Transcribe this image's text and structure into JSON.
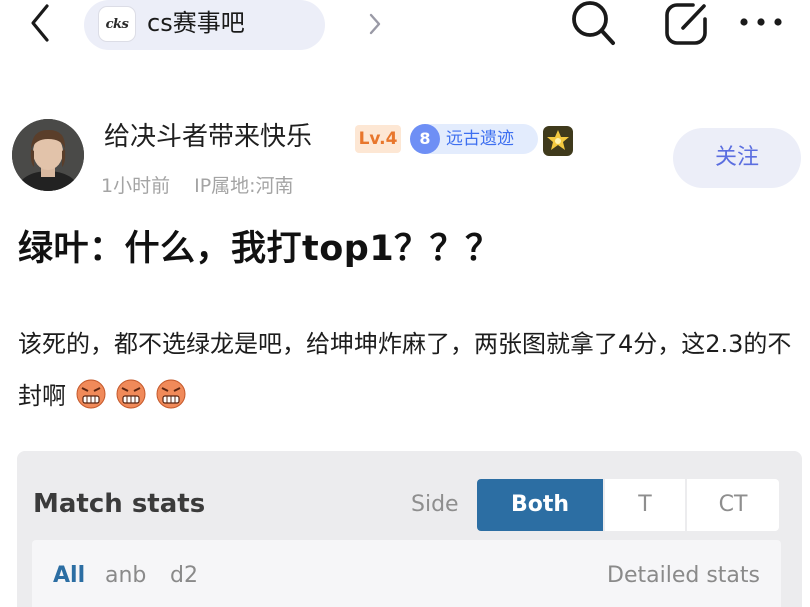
{
  "header": {
    "forum_logo_text": "cks",
    "forum_name": "cs赛事吧"
  },
  "author": {
    "name": "给决斗者带来快乐",
    "level": "Lv.4",
    "title_badge_num": "8",
    "title_badge_text": "远古遗迹",
    "post_time": "1小时前",
    "ip_location": "IP属地:河南",
    "follow_label": "关注"
  },
  "post": {
    "title": "绿叶：什么，我打top1？？？",
    "body": "该死的，都不选绿龙是吧，给坤坤炸麻了，两张图就拿了4分，这2.3的不封啊",
    "emojis": [
      "angry-emoji",
      "angry-emoji",
      "angry-emoji"
    ]
  },
  "stats_card": {
    "title": "Match stats",
    "side_label": "Side",
    "side_options": [
      "Both",
      "T",
      "CT"
    ],
    "selected_side": "Both",
    "filters": [
      "All",
      "anb",
      "d2"
    ],
    "selected_filter": "All",
    "detailed_link": "Detailed stats"
  },
  "colors": {
    "accent_blue": "#2c6ea3",
    "follow_text": "#5b6ee0",
    "level_orange": "#e8762c",
    "badge_blue": "#3d6ff0",
    "pill_bg": "#eceef8"
  },
  "icons": {
    "back": "chevron-left-icon",
    "search": "search-icon",
    "edit": "edit-icon",
    "more": "more-dots-icon",
    "medal": "medal-icon"
  }
}
